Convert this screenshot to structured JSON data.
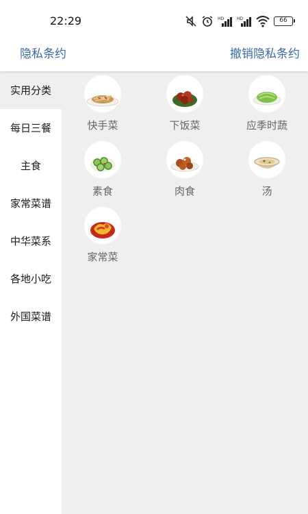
{
  "status_bar": {
    "time": "22:29",
    "battery": "66",
    "icons": [
      "mute-icon",
      "alarm-icon",
      "signal-hd-icon",
      "signal-hd-icon",
      "wifi-icon",
      "battery-icon"
    ]
  },
  "header": {
    "left_link": "隐私条约",
    "right_link": "撤销隐私条约",
    "link_color": "#3a6aa6"
  },
  "sidebar": {
    "items": [
      {
        "label": "实用分类",
        "active": true
      },
      {
        "label": "每日三餐"
      },
      {
        "label": "主食"
      },
      {
        "label": "家常菜谱"
      },
      {
        "label": "中华菜系"
      },
      {
        "label": "各地小吃"
      },
      {
        "label": "外国菜谱"
      }
    ]
  },
  "categories": [
    {
      "label": "快手菜",
      "icon": "stir-fry-dish-icon"
    },
    {
      "label": "下饭菜",
      "icon": "braised-meat-dish-icon"
    },
    {
      "label": "应季时蔬",
      "icon": "green-vegetable-dish-icon"
    },
    {
      "label": "素食",
      "icon": "cucumber-salad-icon"
    },
    {
      "label": "肉食",
      "icon": "fried-meat-dish-icon"
    },
    {
      "label": "汤",
      "icon": "soup-bowl-icon"
    },
    {
      "label": "家常菜",
      "icon": "tomato-egg-dish-icon"
    }
  ]
}
